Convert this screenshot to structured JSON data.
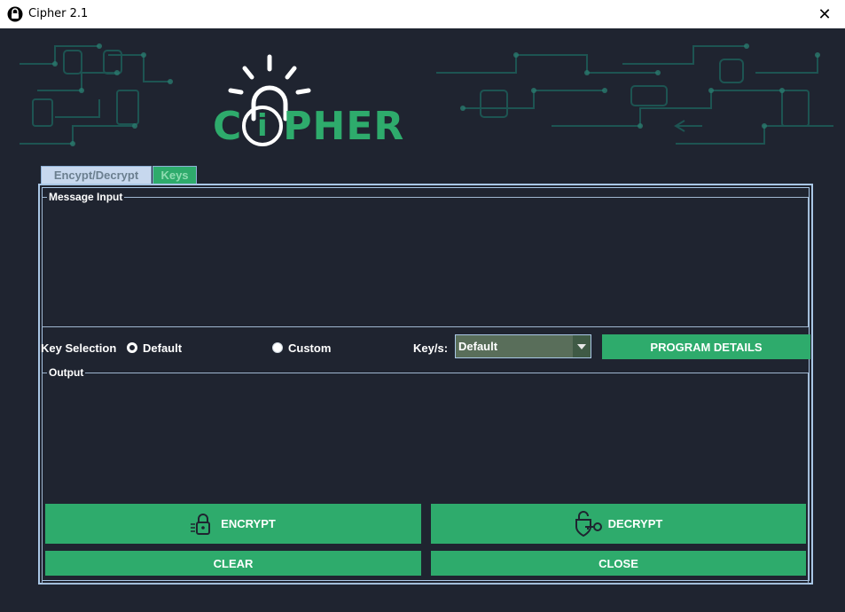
{
  "window": {
    "title": "Cipher 2.1",
    "app_icon": "lock-icon",
    "close_glyph": "✕"
  },
  "banner": {
    "logo_text_left": "C",
    "logo_text_mid": "i",
    "logo_text_right": "PHER",
    "accent": "#2eab6c",
    "background": "#1f2430"
  },
  "tabs": [
    {
      "label": "Encypt/Decrypt"
    },
    {
      "label": "Keys"
    }
  ],
  "message_input": {
    "title": "Message  Input",
    "value": ""
  },
  "key_selection": {
    "label": "Key Selection",
    "options": [
      {
        "label": "Default",
        "selected": true
      },
      {
        "label": "Custom",
        "selected": false
      }
    ]
  },
  "keys": {
    "label": "Key/s:",
    "selected": "Default"
  },
  "program_details_label": "PROGRAM DETAILS",
  "output": {
    "title": "Output",
    "value": ""
  },
  "buttons": {
    "encrypt": "ENCRYPT",
    "decrypt": "DECRYPT",
    "clear": "CLEAR",
    "close": "CLOSE"
  },
  "colors": {
    "accent": "#2eab6c",
    "window_bg": "#1f2430",
    "border": "#a9c7e6"
  }
}
